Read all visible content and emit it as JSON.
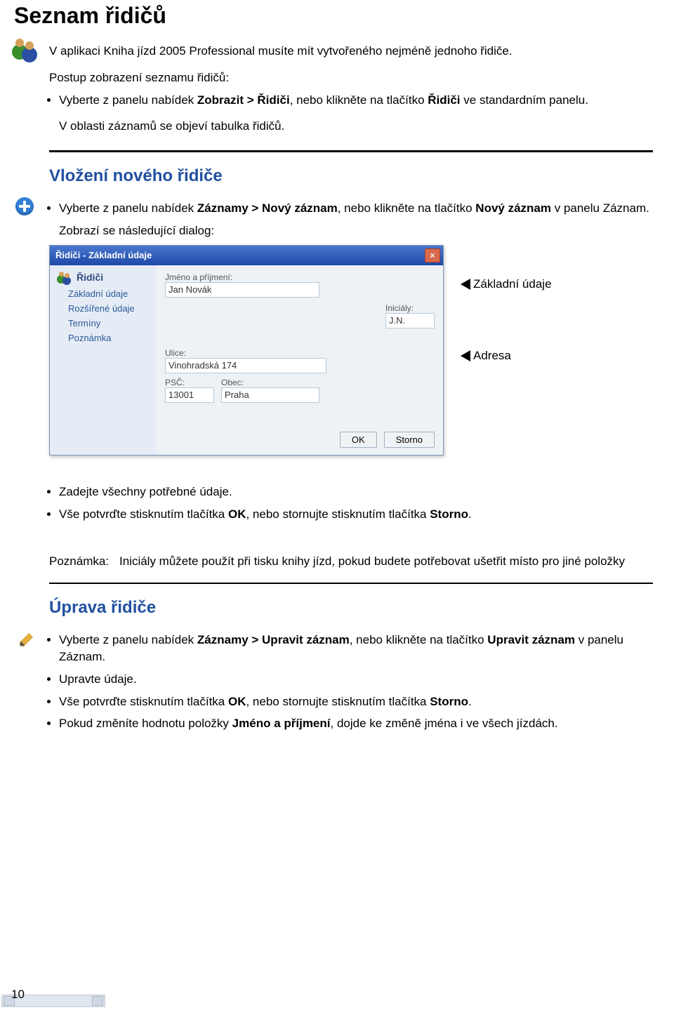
{
  "h1": "Seznam řidičů",
  "intro": "V aplikaci Kniha jízd 2005 Professional musíte mít vytvořeného nejméně jednoho řidiče.",
  "intro2": "Postup zobrazení seznamu řidičů:",
  "introList": {
    "a_pre": "Vyberte z panelu nabídek ",
    "a_b1": "Zobrazit > Řidiči",
    "a_mid": ", nebo klikněte na tlačítko ",
    "a_b2": "Řidiči",
    "a_post": " ve standardním panelu.",
    "b": "V oblasti záznamů se objeví tabulka řidičů."
  },
  "sec1": {
    "title": "Vložení nového řidiče",
    "li_pre": "Vyberte z panelu nabídek ",
    "li_b1": "Záznamy > Nový záznam",
    "li_mid": ", nebo klikněte na tlačítko ",
    "li_b2": "Nový záznam",
    "li_post": " v panelu Záznam.",
    "after": "Zobrazí se následující dialog:"
  },
  "dialog": {
    "title": "Řidiči - Základní údaje",
    "close": "×",
    "sb_header": "Řidiči",
    "sb_items": [
      "Základní údaje",
      "Rozšířené údaje",
      "Termíny",
      "Poznámka"
    ],
    "lbl_name": "Jméno a příjmení:",
    "val_name": "Jan Novák",
    "lbl_init": "Iniciály:",
    "val_init": "J.N.",
    "lbl_street": "Ulice:",
    "val_street": "Vinohradská 174",
    "lbl_psc": "PSČ:",
    "val_psc": "13001",
    "lbl_city": "Obec:",
    "val_city": "Praha",
    "btn_ok": "OK",
    "btn_cancel": "Storno"
  },
  "callout1": "Základní údaje",
  "callout2": "Adresa",
  "sec1b": {
    "li1": "Zadejte všechny potřebné údaje.",
    "li2_pre": "Vše potvrďte stisknutím tlačítka ",
    "li2_b1": "OK",
    "li2_mid": ", nebo stornujte stisknutím tlačítka ",
    "li2_b2": "Storno",
    "li2_post": "."
  },
  "note": {
    "label": "Poznámka:",
    "text": " Iniciály můžete použít při tisku knihy jízd, pokud budete potřebovat ušetřit místo pro jiné položky"
  },
  "sec2": {
    "title": "Úprava řidiče",
    "li1_pre": "Vyberte z panelu nabídek ",
    "li1_b1": "Záznamy > Upravit záznam",
    "li1_mid": ", nebo klikněte na tlačítko ",
    "li1_b2": "Upravit záznam",
    "li1_post": " v panelu Záznam.",
    "li2": "Upravte údaje.",
    "li3_pre": "Vše potvrďte stisknutím tlačítka ",
    "li3_b1": "OK",
    "li3_mid": ", nebo stornujte stisknutím tlačítka ",
    "li3_b2": "Storno",
    "li3_post": ".",
    "li4_pre": "Pokud změníte hodnotu položky ",
    "li4_b1": "Jméno a příjmení",
    "li4_post": ", dojde ke změně jména i ve všech jízdách."
  },
  "page": "10"
}
